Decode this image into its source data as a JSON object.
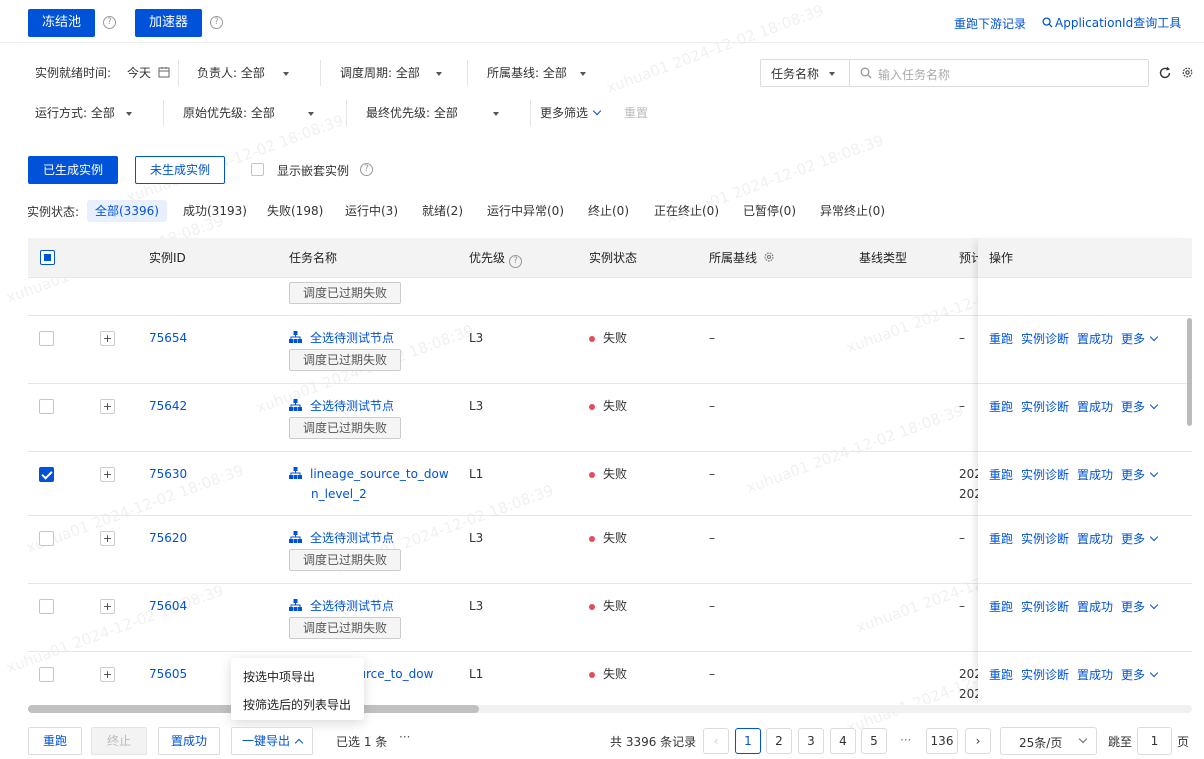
{
  "toolbar": {
    "freeze_pool": "冻结池",
    "accelerator": "加速器",
    "rerun_downstream": "重跑下游记录",
    "app_id_tool": "ApplicationId查询工具"
  },
  "filters": {
    "ready_time_label": "实例就绪时间:",
    "ready_time_value": "今天",
    "owner": "负责人: 全部",
    "cycle": "调度周期: 全部",
    "baseline": "所属基线: 全部",
    "search_field": "任务名称",
    "search_placeholder": "输入任务名称",
    "run_mode": "运行方式: 全部",
    "orig_priority": "原始优先级: 全部",
    "final_priority": "最终优先级: 全部",
    "more_filters": "更多筛选",
    "reset": "重置"
  },
  "tabs": {
    "generated": "已生成实例",
    "not_generated": "未生成实例",
    "show_nested": "显示嵌套实例"
  },
  "status": {
    "label": "实例状态:",
    "items": [
      "全部(3396)",
      "成功(3193)",
      "失败(198)",
      "运行中(3)",
      "就绪(2)",
      "运行中异常(0)",
      "终止(0)",
      "正在终止(0)",
      "已暂停(0)",
      "异常终止(0)"
    ]
  },
  "table": {
    "headers": {
      "id": "实例ID",
      "name": "任务名称",
      "priority": "优先级",
      "state": "实例状态",
      "baseline": "所属基线",
      "baseline_type": "基线类型",
      "expected": "预计",
      "ops": "操作"
    },
    "expired_tag": "调度已过期失败",
    "rows": [
      {
        "id": "75654",
        "name": "全选待测试节点",
        "priority": "L3",
        "state": "失败",
        "baseline": "–",
        "expected": "–",
        "checked": false,
        "tag": "调度已过期失败"
      },
      {
        "id": "75642",
        "name": "全选待测试节点",
        "priority": "L3",
        "state": "失败",
        "baseline": "–",
        "expected": "–",
        "checked": false,
        "tag": "调度已过期失败"
      },
      {
        "id": "75630",
        "name": "lineage_source_to_dow",
        "name2": "n_level_2",
        "priority": "L1",
        "state": "失败",
        "baseline": "–",
        "expected": "202",
        "expected2": "202",
        "checked": true
      },
      {
        "id": "75620",
        "name": "全选待测试节点",
        "priority": "L3",
        "state": "失败",
        "baseline": "–",
        "expected": "–",
        "checked": false,
        "tag": "调度已过期失败"
      },
      {
        "id": "75604",
        "name": "全选待测试节点",
        "priority": "L3",
        "state": "失败",
        "baseline": "–",
        "expected": "–",
        "checked": false,
        "tag": "调度已过期失败"
      },
      {
        "id": "75605",
        "name": "ource_to_dow",
        "priority": "L1",
        "state": "失败",
        "baseline": "–",
        "expected": "202",
        "expected2": "202",
        "checked": false
      }
    ],
    "ops": {
      "rerun": "重跑",
      "diagnose": "实例诊断",
      "set_success": "置成功",
      "more": "更多"
    }
  },
  "export_menu": {
    "selected": "按选中项导出",
    "filtered": "按筛选后的列表导出"
  },
  "footer": {
    "rerun": "重跑",
    "terminate": "终止",
    "set_success": "置成功",
    "export": "一键导出",
    "selected": "已选 1 条",
    "dots": "···",
    "total": "共 3396 条记录",
    "pages": [
      "1",
      "2",
      "3",
      "4",
      "5"
    ],
    "ellipsis": "···",
    "last_page": "136",
    "page_size": "25条/页",
    "jump_label": "跳至",
    "jump_value": "1",
    "page_unit": "页"
  },
  "watermark": "xuhua01 2024-12-02 18:08:39",
  "colors": {
    "primary": "#0052d9",
    "error": "#e34d59"
  }
}
